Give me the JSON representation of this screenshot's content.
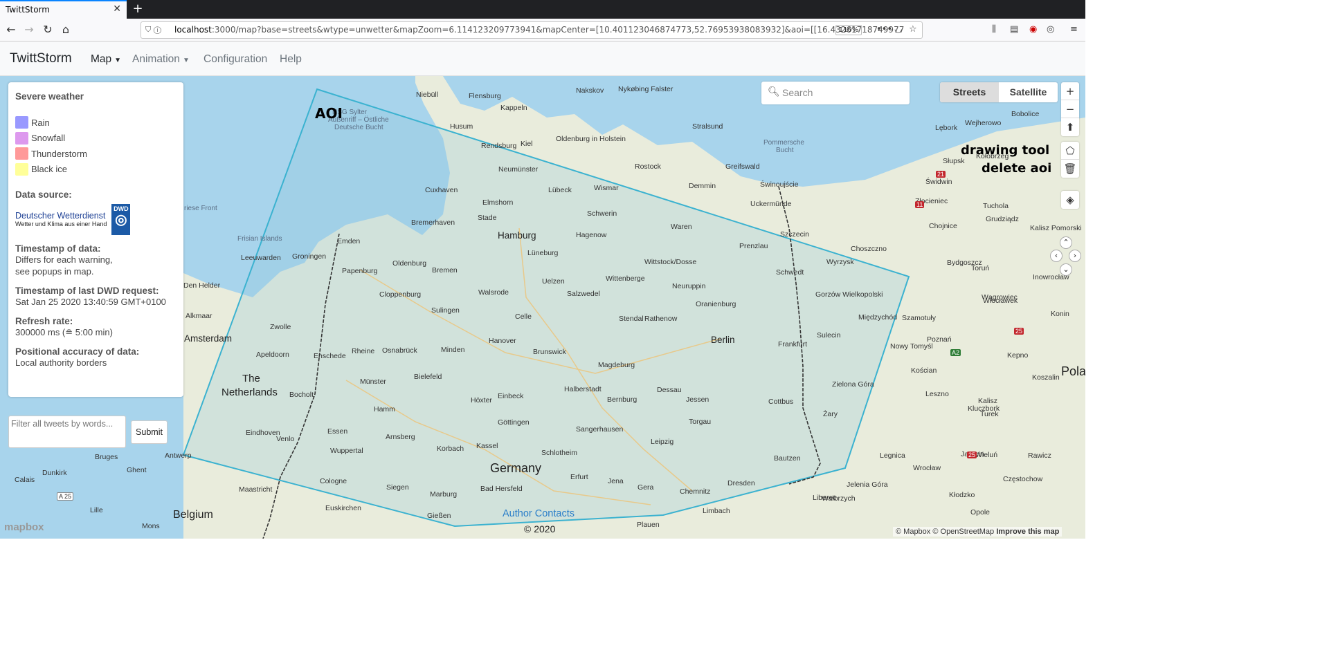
{
  "browser": {
    "tab_title": "TwittStorm",
    "url_host": "localhost",
    "url_rest": ":3000/map?base=streets&wtype=unwetter&mapZoom=6.114123209773941&mapCenter=[10.401123046874773,52.76953938083932]&aoi=[[16.43261718749977",
    "zoom": "110%"
  },
  "app": {
    "brand": "TwittStorm",
    "nav": [
      {
        "label": "Map",
        "dropdown": true,
        "active": true
      },
      {
        "label": "Animation",
        "dropdown": true,
        "active": false
      },
      {
        "label": "Configuration",
        "dropdown": false,
        "active": false
      },
      {
        "label": "Help",
        "dropdown": false,
        "active": false
      }
    ]
  },
  "legend": {
    "title": "Severe weather",
    "items": [
      {
        "label": "Rain",
        "color": "#9999ff"
      },
      {
        "label": "Snowfall",
        "color": "#dd99ee"
      },
      {
        "label": "Thunderstorm",
        "color": "#ff9999"
      },
      {
        "label": "Black ice",
        "color": "#ffff99"
      }
    ],
    "data_source_title": "Data source:",
    "dwd_name": "Deutscher Wetterdienst",
    "dwd_tagline": "Wetter und Klima aus einer Hand",
    "dwd_logo": "DWD",
    "timestamp_title": "Timestamp of data:",
    "timestamp_text_1": "Differs for each warning,",
    "timestamp_text_2": "see popups in map.",
    "last_request_title": "Timestamp of last DWD request:",
    "last_request_value": "Sat Jan 25 2020 13:40:59 GMT+0100",
    "refresh_title": "Refresh rate:",
    "refresh_value": "300000 ms (≘ 5:00 min)",
    "accuracy_title": "Positional accuracy of data:",
    "accuracy_value": "Local authority borders"
  },
  "filter": {
    "placeholder": "Filter all tweets by words...",
    "submit_label": "Submit"
  },
  "map": {
    "search_placeholder": "Search",
    "styles": [
      "Streets",
      "Satellite"
    ],
    "selected_style": "Streets",
    "aoi_label": "AOI",
    "drawing_tool_label": "drawing tool",
    "delete_aoi_label": "delete aoi",
    "author_contacts": "Author Contacts",
    "copyright": "© 2020",
    "attribution": "© Mapbox © OpenStreetMap",
    "improve": "Improve this map",
    "mapbox_logo": "mapbox",
    "aoi_color": "#3bb2d0",
    "water_color": "#a8d4ec",
    "land_color": "#e9ecdc",
    "labels": {
      "germany": "Germany",
      "netherlands_1": "The",
      "netherlands_2": "Netherlands",
      "belgium": "Belgium",
      "hamburg": "Hamburg",
      "berlin": "Berlin",
      "amsterdam": "Amsterdam",
      "nsg_1": "NSG Sylter",
      "nsg_2": "Außenriff – Östliche",
      "nsg_3": "Deutsche Bucht",
      "pommersche_1": "Pommersche",
      "pommersche_2": "Bucht",
      "frisian": "Frisian Islands",
      "friese": "riese Front",
      "pola": "Pola"
    },
    "cities": [
      "Niebüll",
      "Flensburg",
      "Nakskov",
      "Nykøbing Falster",
      "Kappeln",
      "Husum",
      "Rendsburg",
      "Kiel",
      "Oldenburg in Holstein",
      "Stralsund",
      "Greifswald",
      "Rostock",
      "Neumünster",
      "Wismar",
      "Lübeck",
      "Demmin",
      "Świnoujście",
      "Cuxhaven",
      "Elmshorn",
      "Uckermünde",
      "Stade",
      "Schwerin",
      "Bremerhaven",
      "Waren",
      "Emden",
      "Hagenow",
      "Szczecin",
      "Prenzlau",
      "Oldenburg",
      "Papenburg",
      "Bremen",
      "Lüneburg",
      "Wittstock/Dosse",
      "Schwedt",
      "Uelzen",
      "Wittenberge",
      "Neuruppin",
      "Cloppenburg",
      "Walsrode",
      "Salzwedel",
      "Oranienburg",
      "Sulingen",
      "Celle",
      "Stendal",
      "Rathenow",
      "Hanover",
      "Brunswick",
      "Magdeburg",
      "Osnabrück",
      "Rheine",
      "Minden",
      "Enschede",
      "Bielefeld",
      "Münster",
      "Einbeck",
      "Halberstadt",
      "Dessau",
      "Bernburg",
      "Jessen",
      "Cottbus",
      "Frankfurt",
      "Hamm",
      "Höxter",
      "Göttingen",
      "Torgau",
      "Essen",
      "Arnsberg",
      "Sangerhausen",
      "Leipzig",
      "Kassel",
      "Wuppertal",
      "Korbach",
      "Schlotheim",
      "Bautzen",
      "Erfurt",
      "Jena",
      "Gera",
      "Chemnitz",
      "Dresden",
      "Cologne",
      "Siegen",
      "Marburg",
      "Bad Hersfeld",
      "Plauen",
      "Gießen",
      "Euskirchen",
      "Limbach",
      "Liberec",
      "Zwolle",
      "Apeldoorn",
      "Leeuwarden",
      "Groningen",
      "Alkmaar",
      "Den Helder",
      "Eindhoven",
      "Venlo",
      "Antwerp",
      "Bruges",
      "Ghent",
      "Dunkirk",
      "Calais",
      "Lille",
      "Maastricht",
      "Mons",
      "Bocholt",
      "Gorzów Wielkopolski",
      "Międzychód",
      "Szamotuły",
      "Sulecin",
      "Nowy Tomyśl",
      "Poznań",
      "Kościan",
      "Zielona Góra",
      "Żary",
      "Leszno",
      "Legnica",
      "Wrocław",
      "Jelenia Góra",
      "Wałbrzych",
      "Opole",
      "Kłodzko",
      "Jarocin",
      "Kalisz",
      "Turek",
      "Koszalin",
      "Kołobrzeg",
      "Słupsk",
      "Lębork",
      "Wejherowo",
      "Bobolice",
      "Świdwin",
      "Złocieniec",
      "Chojnice",
      "Tuchola",
      "Grudziądz",
      "Kalisz Pomorski",
      "Choszczno",
      "Wyrzysk",
      "Bydgoszcz",
      "Toruń",
      "Inowrocław",
      "Wągrowiec",
      "Włocławek",
      "Konin",
      "Kepno",
      "Wieluń",
      "Rawicz",
      "Kluczbork",
      "Częstochow"
    ]
  }
}
